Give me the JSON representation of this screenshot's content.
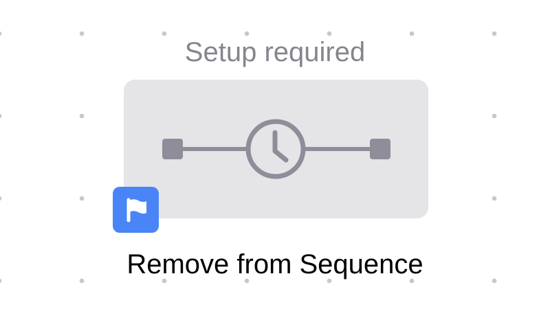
{
  "node": {
    "status": "Setup required",
    "label": "Remove from Sequence",
    "card_icon": "timeline-clock-icon",
    "badge_icon": "flag-icon",
    "colors": {
      "card_background": "#e5e5e8",
      "icon": "#8e8d99",
      "badge": "#4a85f7",
      "status_text": "#85848f",
      "grid_dot": "#c8c8cc"
    }
  }
}
